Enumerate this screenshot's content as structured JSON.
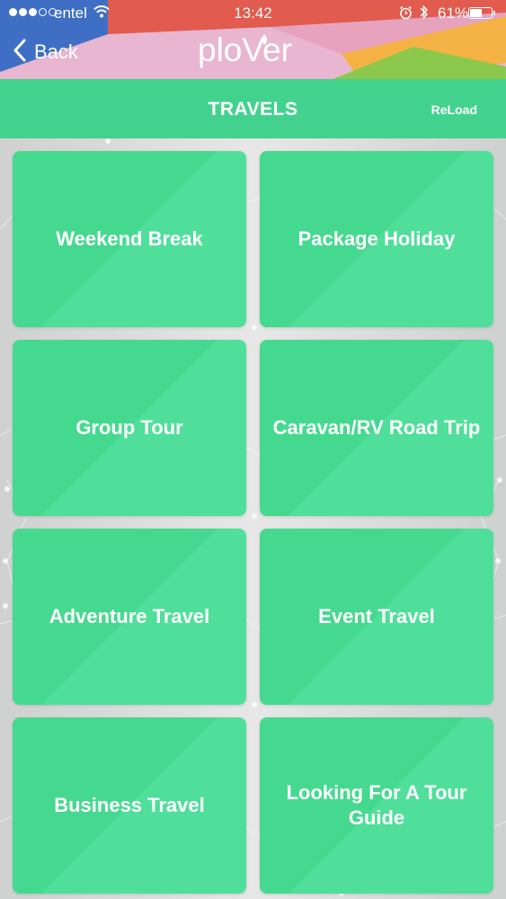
{
  "status_bar": {
    "carrier": "entel",
    "time": "13:42",
    "battery_percent": "61%",
    "battery_level": 0.61,
    "signal_bars_filled": 3,
    "signal_bars_total": 5
  },
  "nav": {
    "back_label": "Back",
    "logo_text": "ploVer"
  },
  "header": {
    "title": "TRAVELS",
    "reload_label": "ReLoad"
  },
  "categories": [
    {
      "label": "Weekend Break"
    },
    {
      "label": "Package Holiday"
    },
    {
      "label": "Group Tour"
    },
    {
      "label": "Caravan/RV Road Trip"
    },
    {
      "label": "Adventure Travel"
    },
    {
      "label": "Event Travel"
    },
    {
      "label": "Business Travel"
    },
    {
      "label": "Looking For A Tour Guide"
    }
  ],
  "colors": {
    "accent_green": "#43d28d",
    "tile_green": "#45d98f",
    "header_pink": "#e8b6d0",
    "header_blue": "#3f6fc5",
    "header_red": "#e15b4f",
    "header_orange": "#f3b243",
    "header_lime": "#8cc84b"
  },
  "icons": {
    "back": "chevron-left-icon",
    "wifi": "wifi-icon",
    "alarm": "alarm-clock-icon",
    "bluetooth": "bluetooth-icon",
    "battery": "battery-icon"
  }
}
